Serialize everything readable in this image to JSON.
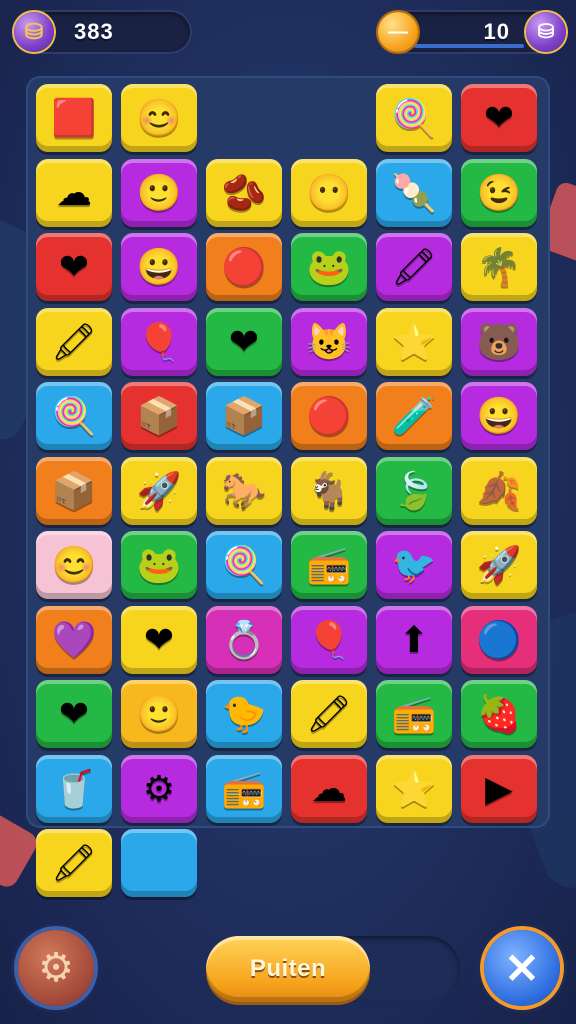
{
  "hud": {
    "left_value": "383",
    "right_value": "10",
    "left_icon": "gem-icon",
    "coin_icon": "coin-icon",
    "right_icon": "gem-icon",
    "left_glyph": "⛁",
    "coin_glyph": "—",
    "gem_glyph": "⛁"
  },
  "board": {
    "rows": [
      [
        {
          "color": "#f7d51e",
          "icon": "red-box-icon",
          "glyph": "🟥"
        },
        {
          "color": "#f7d51e",
          "icon": "red-face-icon",
          "glyph": "😊"
        },
        null,
        null,
        {
          "color": "#f7d51e",
          "icon": "popsicle-icon",
          "glyph": "🍭"
        },
        {
          "color": "#e5322f",
          "icon": "heart-icon",
          "glyph": "❤"
        }
      ],
      [
        {
          "color": "#f7d51e",
          "icon": "green-cloud-icon",
          "glyph": "☁"
        },
        {
          "color": "#b62be0",
          "icon": "blue-face-icon",
          "glyph": "🙂"
        },
        {
          "color": "#f7d51e",
          "icon": "jellybean-icon",
          "glyph": "🫘"
        },
        {
          "color": "#f7d51e",
          "icon": "purple-face-icon",
          "glyph": "😶"
        },
        {
          "color": "#2aa8ea",
          "icon": "popsicle-icon",
          "glyph": "🍡"
        },
        {
          "color": "#24b845",
          "icon": "wink-face-icon",
          "glyph": "😉"
        }
      ],
      [
        {
          "color": "#e5322f",
          "icon": "heart-icon",
          "glyph": "❤"
        },
        {
          "color": "#b62be0",
          "icon": "yellow-face-icon",
          "glyph": "😀"
        },
        {
          "color": "#f07f1c",
          "icon": "red-blob-icon",
          "glyph": "🔴"
        },
        {
          "color": "#24b845",
          "icon": "green-creature-icon",
          "glyph": "🐸"
        },
        {
          "color": "#b62be0",
          "icon": "crayon-icon",
          "glyph": "🖍"
        },
        {
          "color": "#f7d51e",
          "icon": "palm-tree-icon",
          "glyph": "🌴"
        }
      ],
      [
        {
          "color": "#f7d51e",
          "icon": "crayon-icon",
          "glyph": "🖍"
        },
        {
          "color": "#b62be0",
          "icon": "balloon-icon",
          "glyph": "🎈"
        },
        {
          "color": "#24b845",
          "icon": "heart-icon",
          "glyph": "❤"
        },
        {
          "color": "#b62be0",
          "icon": "blue-creature-icon",
          "glyph": "😺"
        },
        {
          "color": "#f7d51e",
          "icon": "star-icon",
          "glyph": "⭐"
        },
        {
          "color": "#b62be0",
          "icon": "bear-face-icon",
          "glyph": "🐻"
        }
      ],
      [
        {
          "color": "#2aa8ea",
          "icon": "lollipop-icon",
          "glyph": "🍭"
        },
        {
          "color": "#e5322f",
          "icon": "crate-icon",
          "glyph": "📦"
        },
        {
          "color": "#2aa8ea",
          "icon": "box-icon",
          "glyph": "📦"
        },
        {
          "color": "#f07f1c",
          "icon": "red-blob-icon",
          "glyph": "🔴"
        },
        {
          "color": "#f07f1c",
          "icon": "tube-icon",
          "glyph": "🧪"
        },
        {
          "color": "#b62be0",
          "icon": "yellow-face-icon",
          "glyph": "😀"
        }
      ],
      [
        {
          "color": "#f07f1c",
          "icon": "crate-icon",
          "glyph": "📦"
        },
        {
          "color": "#f7d51e",
          "icon": "rocket-icon",
          "glyph": "🚀"
        },
        {
          "color": "#f7d51e",
          "icon": "horse-icon",
          "glyph": "🐎"
        },
        {
          "color": "#f7d51e",
          "icon": "horse-icon",
          "glyph": "🐐"
        },
        {
          "color": "#24b845",
          "icon": "leaf-icon",
          "glyph": "🍃"
        },
        {
          "color": "#f7d51e",
          "icon": "leaf-icon",
          "glyph": "🍂"
        }
      ],
      [
        {
          "color": "#f5c3d4",
          "icon": "smile-face-icon",
          "glyph": "😊"
        },
        {
          "color": "#24b845",
          "icon": "green-creature-icon",
          "glyph": "🐸"
        },
        {
          "color": "#2aa8ea",
          "icon": "lollipop-icon",
          "glyph": "🍭"
        },
        {
          "color": "#24b845",
          "icon": "radio-icon",
          "glyph": "📻"
        },
        {
          "color": "#b62be0",
          "icon": "bird-icon",
          "glyph": "🐦"
        },
        {
          "color": "#f7d51e",
          "icon": "rocket-icon",
          "glyph": "🚀"
        }
      ],
      [
        {
          "color": "#f07f1c",
          "icon": "heart-icon",
          "glyph": "💜"
        },
        {
          "color": "#f7d51e",
          "icon": "heart-icon",
          "glyph": "❤"
        },
        {
          "color": "#d62fb8",
          "icon": "ring-icon",
          "glyph": "💍"
        },
        {
          "color": "#b62be0",
          "icon": "balloon-icon",
          "glyph": "🎈"
        },
        {
          "color": "#b62be0",
          "icon": "arrow-up-icon",
          "glyph": "⬆"
        },
        {
          "color": "#e62f7a",
          "icon": "balloon-icon",
          "glyph": "🔵"
        }
      ],
      [
        {
          "color": "#24b845",
          "icon": "heart-icon",
          "glyph": "❤"
        },
        {
          "color": "#f7b81e",
          "icon": "smile-face-icon",
          "glyph": "🙂"
        },
        {
          "color": "#2aa8ea",
          "icon": "duck-icon",
          "glyph": "🐤"
        },
        {
          "color": "#f7d51e",
          "icon": "crayon-icon",
          "glyph": "🖍"
        },
        {
          "color": "#24b845",
          "icon": "radio-icon",
          "glyph": "📻"
        },
        {
          "color": "#24b845",
          "icon": "berry-icon",
          "glyph": "🍓"
        }
      ],
      [
        {
          "color": "#2aa8ea",
          "icon": "cup-icon",
          "glyph": "🥤"
        },
        {
          "color": "#b62be0",
          "icon": "gear-icon",
          "glyph": "⚙"
        },
        {
          "color": "#2aa8ea",
          "icon": "radio-icon",
          "glyph": "📻"
        },
        {
          "color": "#e5322f",
          "icon": "cloud-icon",
          "glyph": "☁"
        },
        {
          "color": "#f7d51e",
          "icon": "star-icon",
          "glyph": "⭐"
        },
        {
          "color": "#e5322f",
          "icon": "arrow-icon",
          "glyph": "▶"
        }
      ],
      [
        {
          "color": "#f7d51e",
          "icon": "crayon-icon",
          "glyph": "🖍"
        },
        {
          "color": "#2aa8ea",
          "icon": "empty-tile-icon",
          "glyph": ""
        },
        null,
        null,
        null,
        null
      ]
    ]
  },
  "bottom": {
    "settings_icon": "gear-icon",
    "settings_glyph": "⚙",
    "main_button_label": "Puiten",
    "close_icon": "close-icon",
    "close_glyph": "✕"
  }
}
